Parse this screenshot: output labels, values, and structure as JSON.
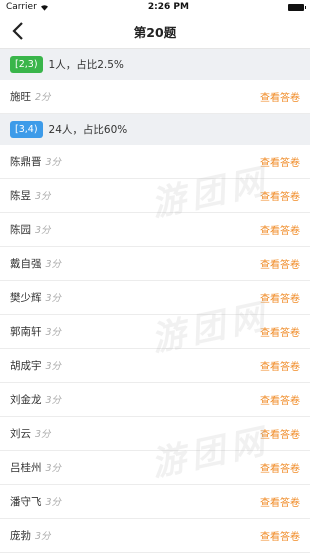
{
  "status_bar": {
    "carrier": "Carrier",
    "time": "2:26 PM"
  },
  "nav": {
    "title": "第20题"
  },
  "colors": {
    "badge_green": "#39b54a",
    "badge_blue": "#3d9be9",
    "action": "#f08a24"
  },
  "groups": [
    {
      "range": "[2,3)",
      "summary": "1人，占比2.5%",
      "rows": [
        {
          "name": "施旺",
          "score": "2分",
          "action": "查看答卷"
        }
      ]
    },
    {
      "range": "[3,4)",
      "summary": "24人，占比60%",
      "rows": [
        {
          "name": "陈鼎晋",
          "score": "3分",
          "action": "查看答卷"
        },
        {
          "name": "陈昱",
          "score": "3分",
          "action": "查看答卷"
        },
        {
          "name": "陈园",
          "score": "3分",
          "action": "查看答卷"
        },
        {
          "name": "戴自强",
          "score": "3分",
          "action": "查看答卷"
        },
        {
          "name": "樊少辉",
          "score": "3分",
          "action": "查看答卷"
        },
        {
          "name": "郭南轩",
          "score": "3分",
          "action": "查看答卷"
        },
        {
          "name": "胡成宇",
          "score": "3分",
          "action": "查看答卷"
        },
        {
          "name": "刘金龙",
          "score": "3分",
          "action": "查看答卷"
        },
        {
          "name": "刘云",
          "score": "3分",
          "action": "查看答卷"
        },
        {
          "name": "吕桂州",
          "score": "3分",
          "action": "查看答卷"
        },
        {
          "name": "潘守飞",
          "score": "3分",
          "action": "查看答卷"
        },
        {
          "name": "庞勃",
          "score": "3分",
          "action": "查看答卷"
        }
      ]
    }
  ],
  "watermark": "游团网"
}
